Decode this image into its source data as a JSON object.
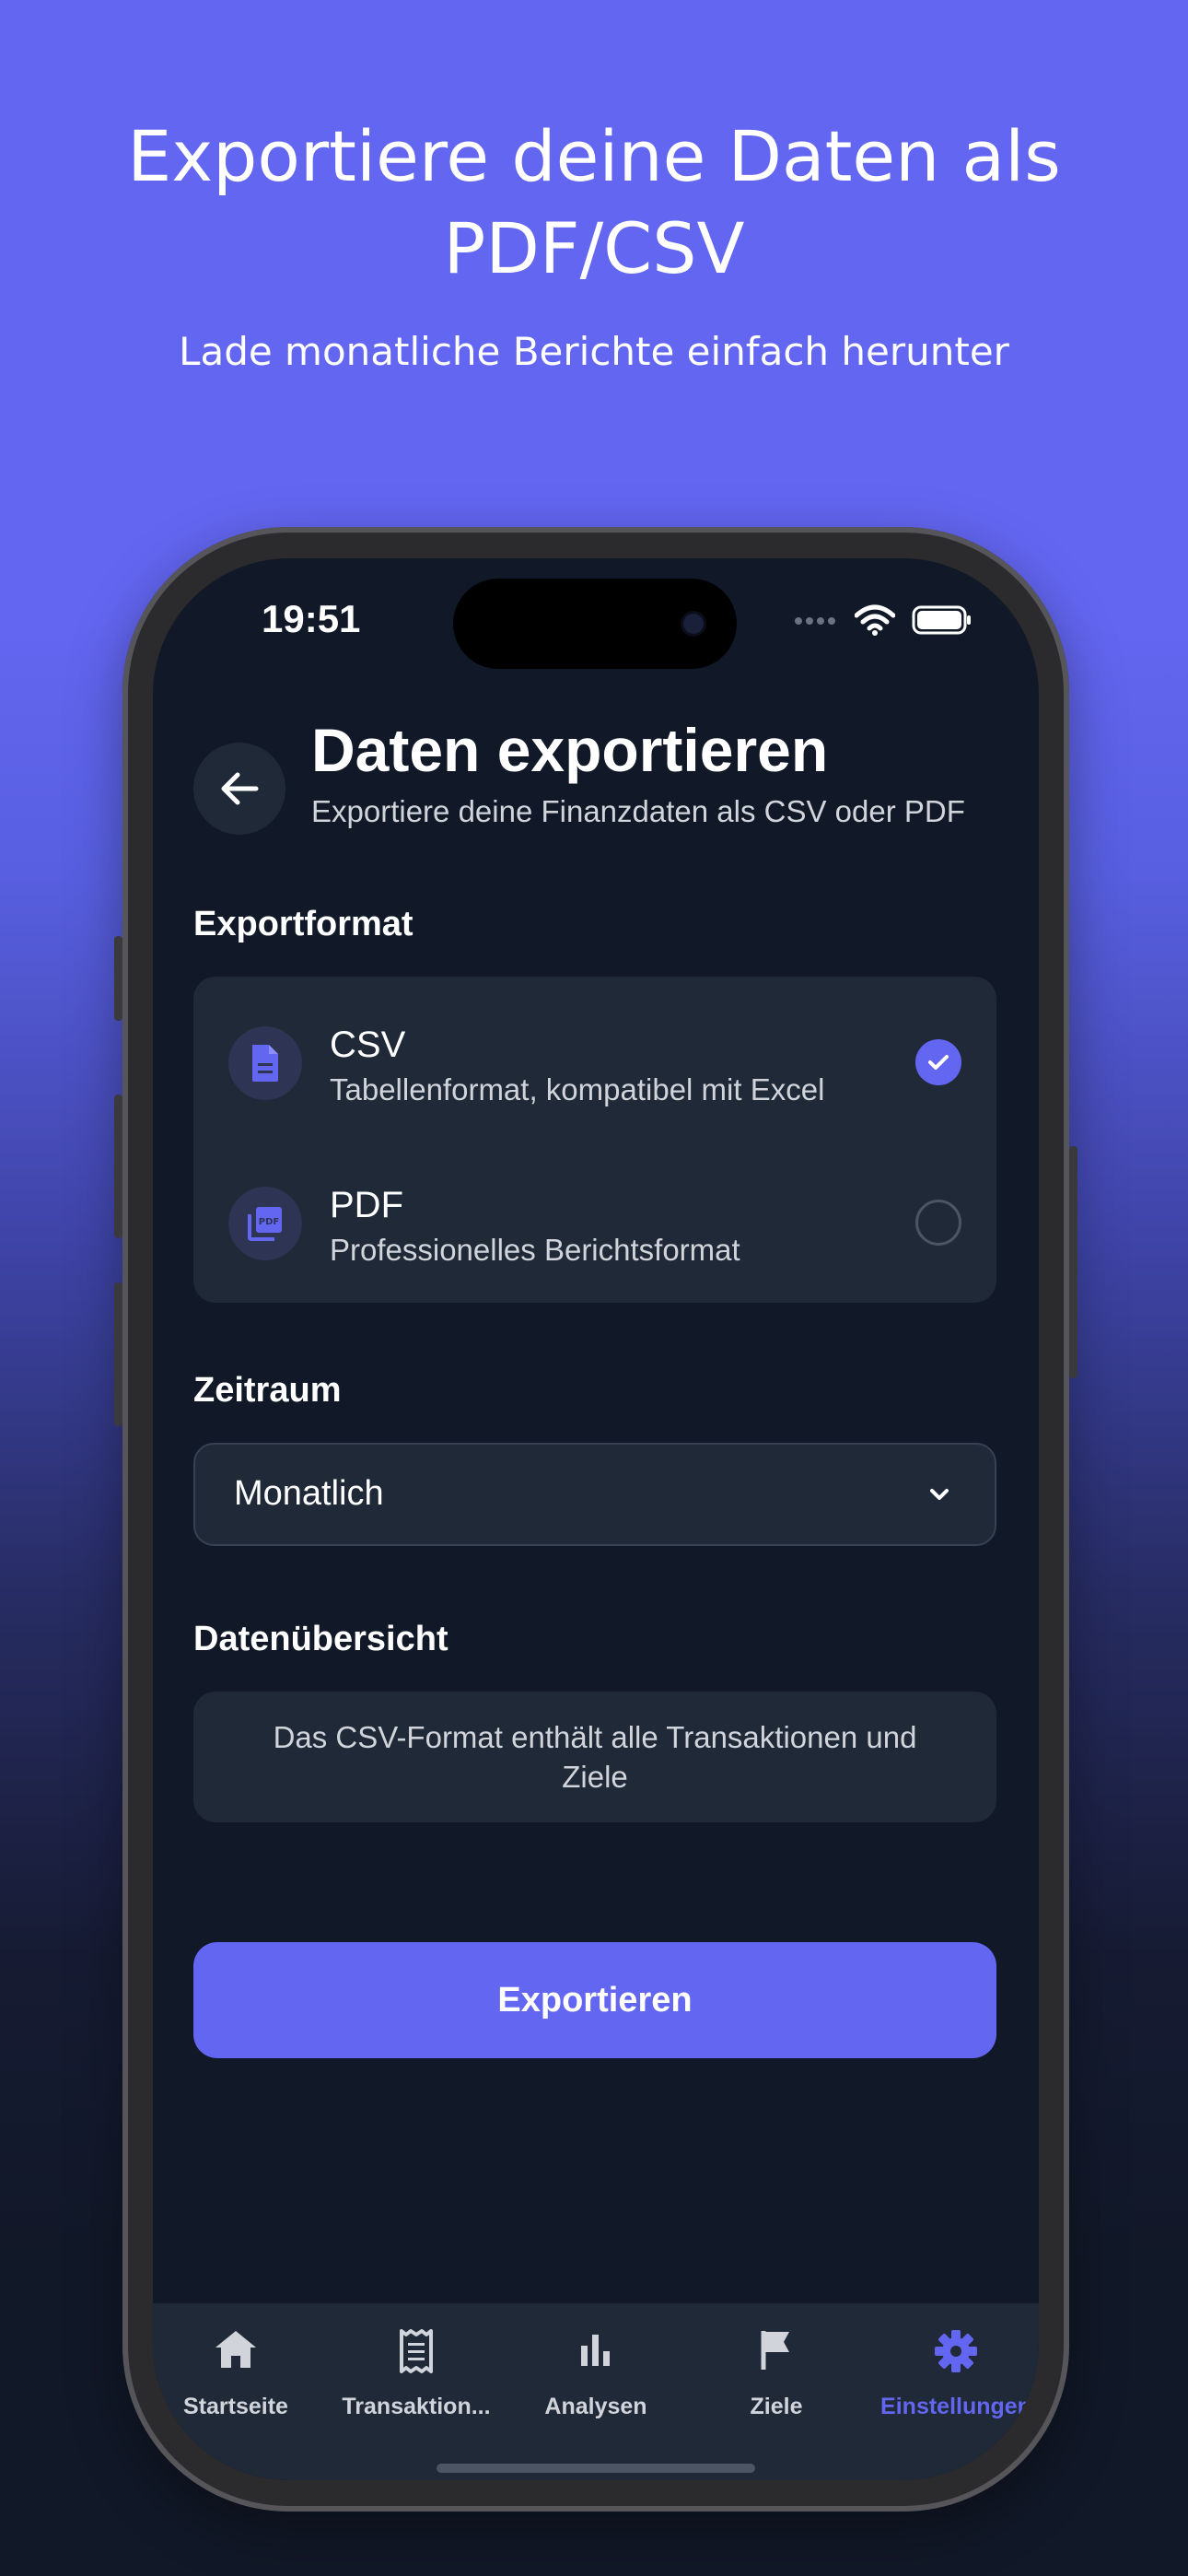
{
  "promo": {
    "title_line1": "Exportiere deine Daten als",
    "title_line2": "PDF/CSV",
    "subtitle": "Lade monatliche Berichte einfach herunter"
  },
  "status_bar": {
    "time": "19:51"
  },
  "header": {
    "title": "Daten exportieren",
    "subtitle": "Exportiere deine Finanzdaten als CSV oder PDF"
  },
  "export_format": {
    "label": "Exportformat",
    "options": [
      {
        "title": "CSV",
        "description": "Tabellenformat, kompatibel mit Excel",
        "selected": true,
        "icon": "document-icon"
      },
      {
        "title": "PDF",
        "description": "Professionelles Berichtsformat",
        "selected": false,
        "icon": "pdf-icon"
      }
    ]
  },
  "period": {
    "label": "Zeitraum",
    "value": "Monatlich"
  },
  "overview": {
    "label": "Datenübersicht",
    "text": "Das CSV-Format enthält alle Transaktionen und Ziele"
  },
  "export_button": {
    "label": "Exportieren"
  },
  "tabs": [
    {
      "label": "Startseite",
      "icon": "home-icon",
      "active": false
    },
    {
      "label": "Transaktion...",
      "icon": "receipt-icon",
      "active": false
    },
    {
      "label": "Analysen",
      "icon": "bar-chart-icon",
      "active": false
    },
    {
      "label": "Ziele",
      "icon": "flag-icon",
      "active": false
    },
    {
      "label": "Einstellungen",
      "icon": "gear-icon",
      "active": true
    }
  ],
  "colors": {
    "accent": "#6366f1",
    "screen_bg": "#111827",
    "card_bg": "#1f2937",
    "text_secondary": "#d1d5db"
  }
}
